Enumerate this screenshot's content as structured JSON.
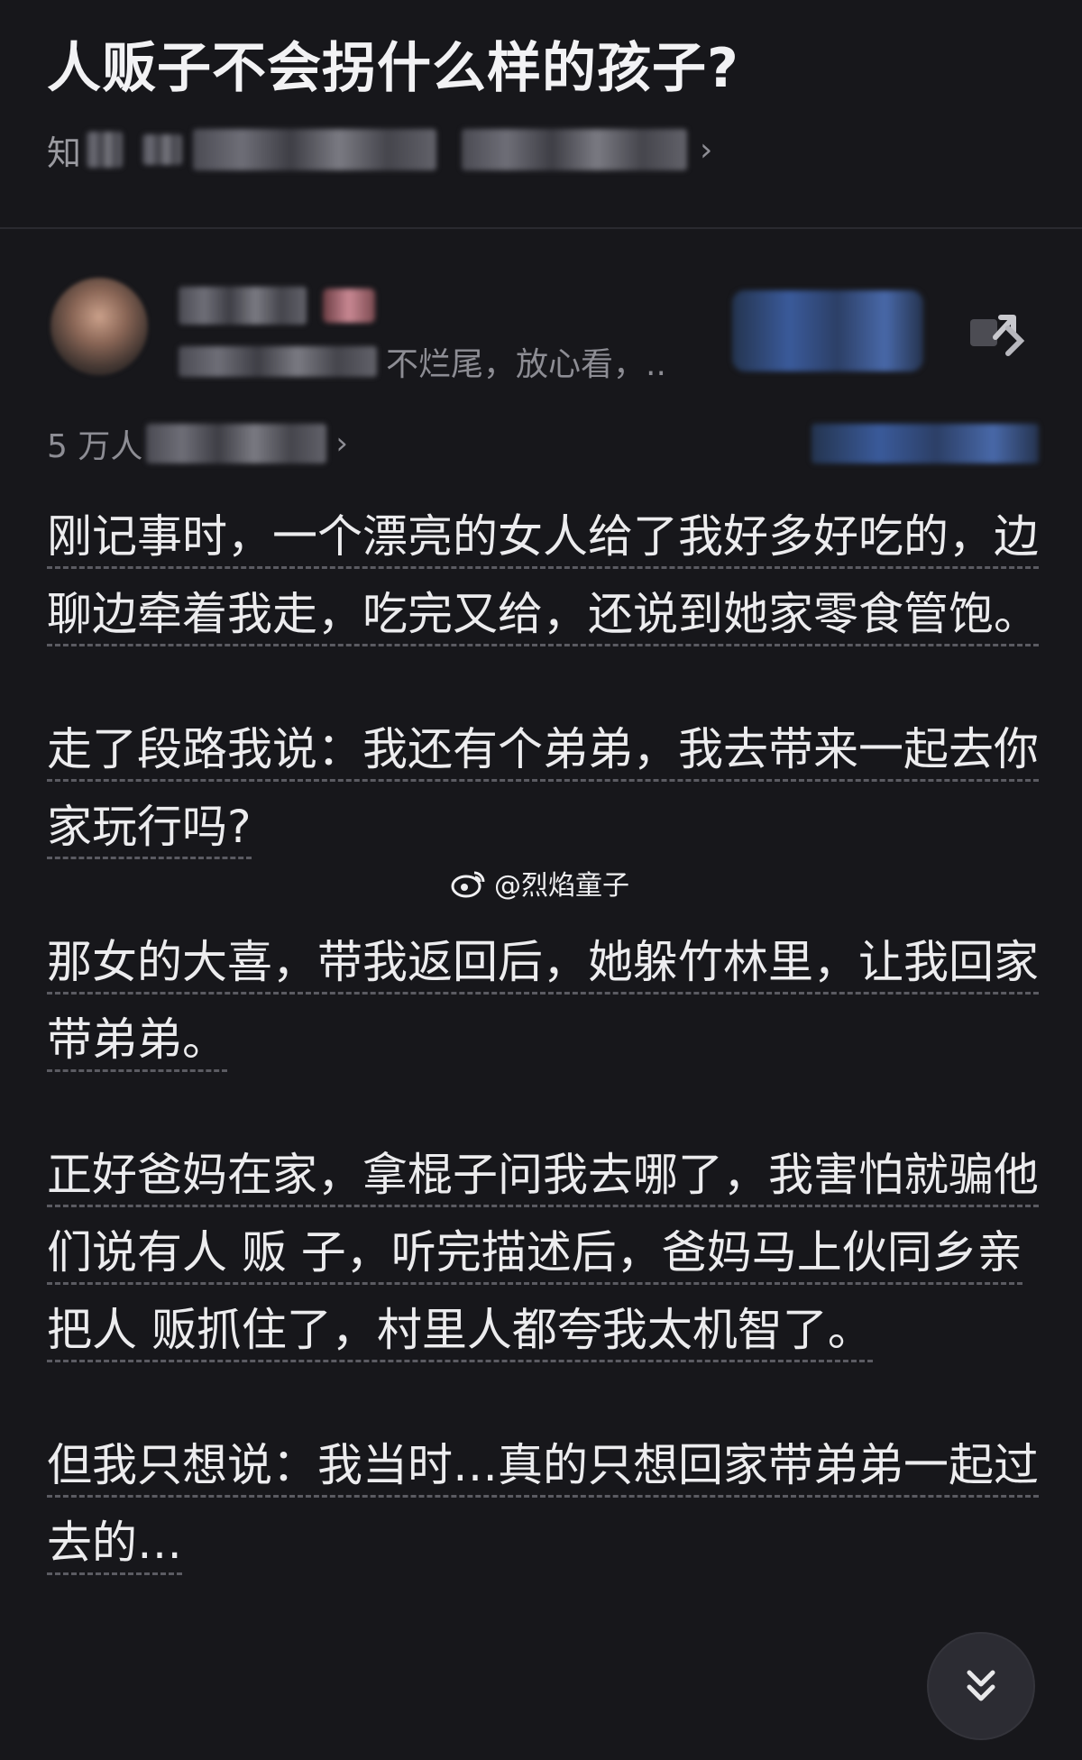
{
  "question": {
    "title": "人贩子不会拐什么样的孩子?",
    "topic_prefix": "知"
  },
  "author": {
    "bio_visible": "不烂尾，放心看，.."
  },
  "stats": {
    "prefix": "5 万人"
  },
  "answer": {
    "paragraphs": [
      "刚记事时，一个漂亮的女人给了我好多好吃的，边聊边牵着我走，吃完又给，还说到她家零食管饱。",
      "走了段路我说：我还有个弟弟，我去带来一起去你家玩行吗?",
      "那女的大喜，带我返回后，她躲竹林里，让我回家带弟弟。",
      "正好爸妈在家，拿棍子问我去哪了，我害怕就骗他们说有人 贩 子，听完描述后，爸妈马上伙同乡亲把人 贩抓住了，村里人都夸我太机智了。",
      "但我只想说：我当时…真的只想回家带弟弟一起过去的…"
    ]
  },
  "watermark": {
    "text": "@烈焰童子",
    "icon": "weibo-icon"
  },
  "icons": {
    "topic_chevron": "chevron-right-icon",
    "share": "share-icon",
    "scroll": "double-chevron-down-icon"
  },
  "colors": {
    "background": "#17171b",
    "text_primary": "#ececee",
    "text_secondary": "#8d8d94",
    "fab": "#2c2c33"
  }
}
